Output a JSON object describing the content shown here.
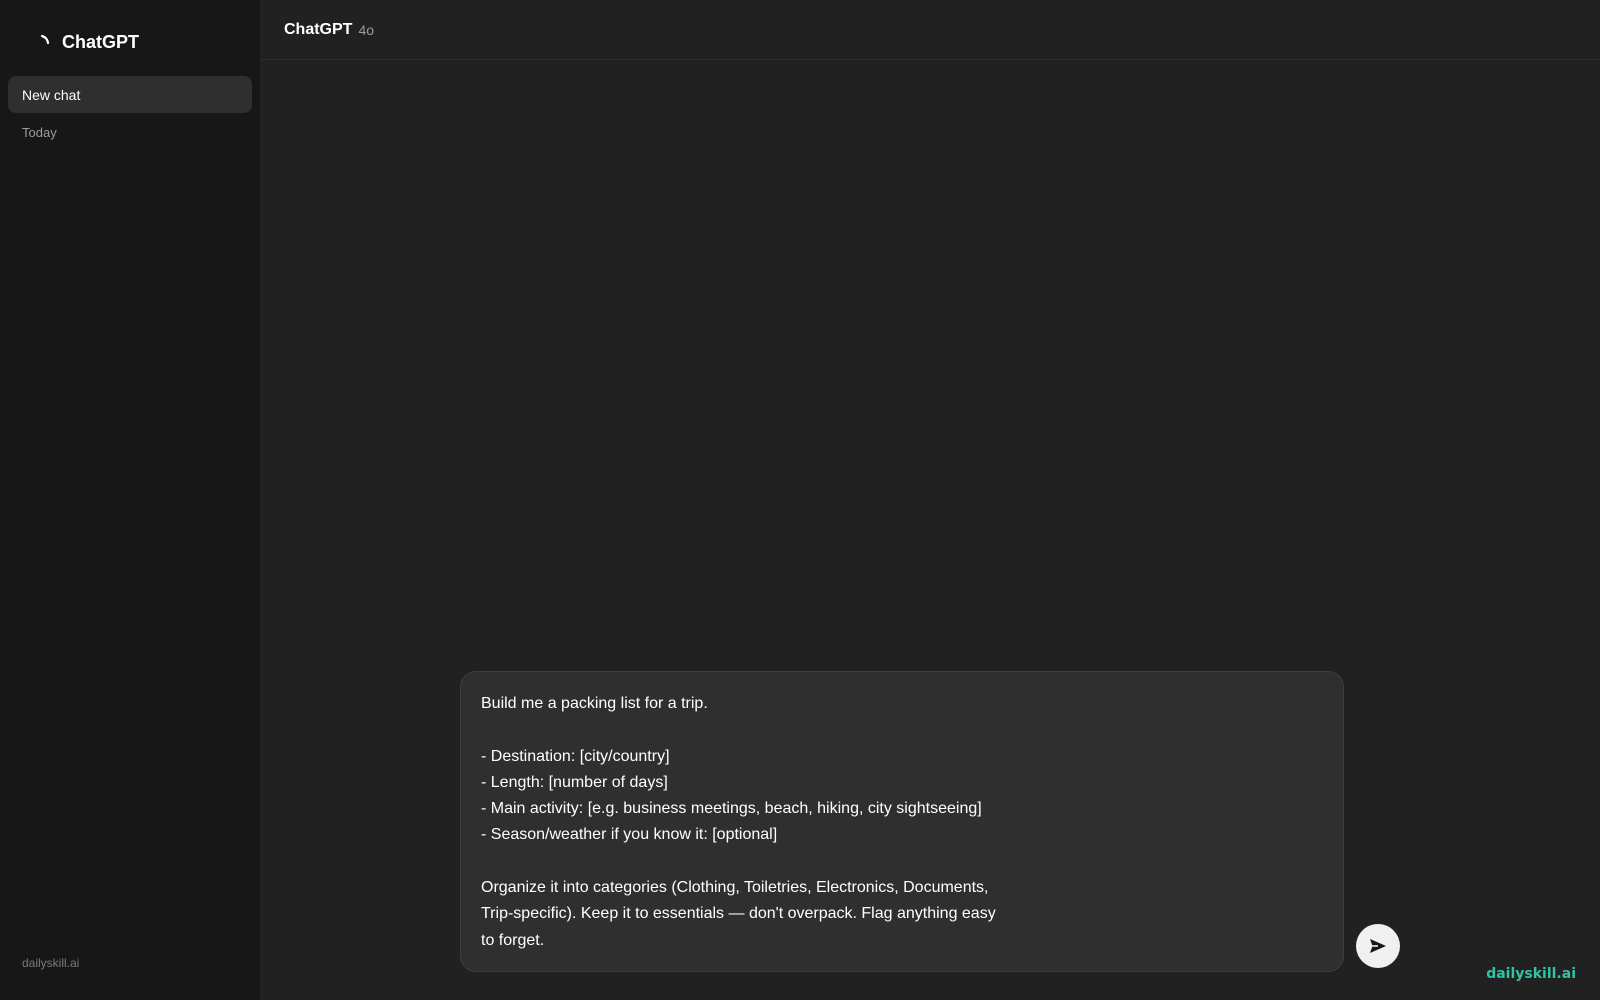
{
  "sidebar": {
    "brand_title": "ChatGPT",
    "new_chat_label": "New chat",
    "section_label": "Today",
    "footer_text": "dailyskill.ai"
  },
  "header": {
    "title": "ChatGPT",
    "model_version": "4o"
  },
  "composer": {
    "value": "Build me a packing list for a trip.\n\n- Destination: [city/country]\n- Length: [number of days]\n- Main activity: [e.g. business meetings, beach, hiking, city sightseeing]\n- Season/weather if you know it: [optional]\n\nOrganize it into categories (Clothing, Toiletries, Electronics, Documents,\nTrip-specific). Keep it to essentials — don't overpack. Flag anything easy\nto forget.",
    "send_icon": "send-arrow-icon"
  },
  "watermark": "dailyskill.ai",
  "colors": {
    "sidebar_bg": "#171717",
    "main_bg": "#212121",
    "composer_bg": "#2f2f2f",
    "accent": "#2ec4a5"
  }
}
